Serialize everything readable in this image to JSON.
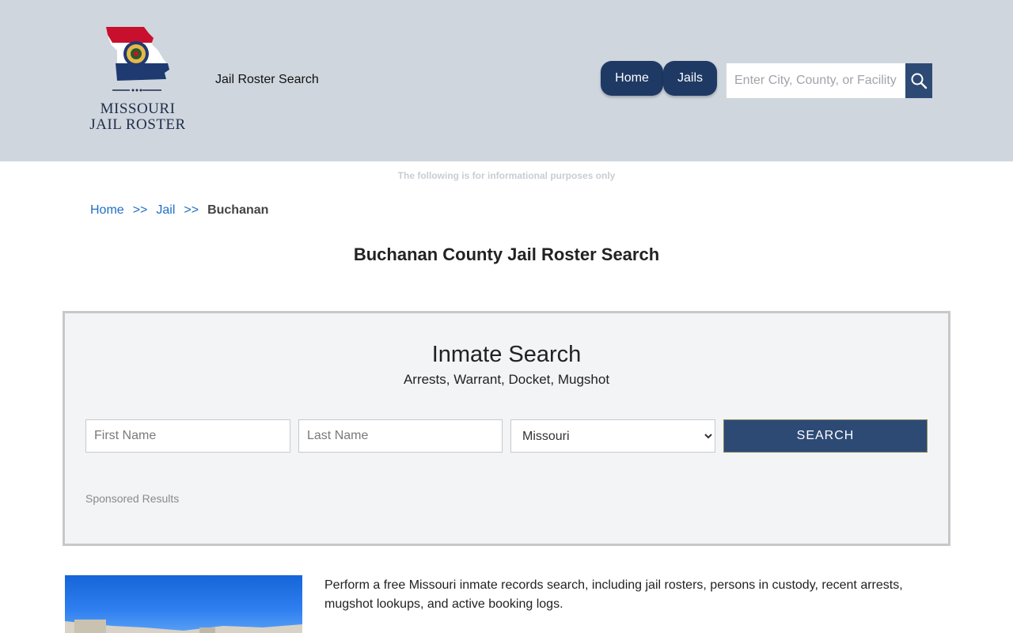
{
  "header": {
    "logo_text_line1": "MISSOURI",
    "logo_text_line2": "JAIL ROSTER",
    "site_name": "Jail Roster Search",
    "nav": [
      {
        "label": "Home"
      },
      {
        "label": "Jails"
      }
    ],
    "search_placeholder": "Enter City, County, or Facility",
    "colors": {
      "nav_bg": "#1e3a64",
      "header_bg": "#cfd6de",
      "search_btn": "#2d4a75"
    }
  },
  "disclaimer": "The following is for informational purposes only",
  "breadcrumb": {
    "items": [
      {
        "label": "Home"
      },
      {
        "label": "Jail"
      }
    ],
    "separator": ">>",
    "current": "Buchanan"
  },
  "page_title": "Buchanan County Jail Roster Search",
  "inmate_search": {
    "title": "Inmate Search",
    "subtitle": "Arrests, Warrant, Docket, Mugshot",
    "first_name_placeholder": "First Name",
    "last_name_placeholder": "Last Name",
    "state_selected": "Missouri",
    "search_label": "SEARCH",
    "sponsored": "Sponsored Results"
  },
  "intro_text": "Perform a free Missouri inmate records search, including jail rosters, persons in custody, recent arrests, mugshot lookups, and active booking logs."
}
